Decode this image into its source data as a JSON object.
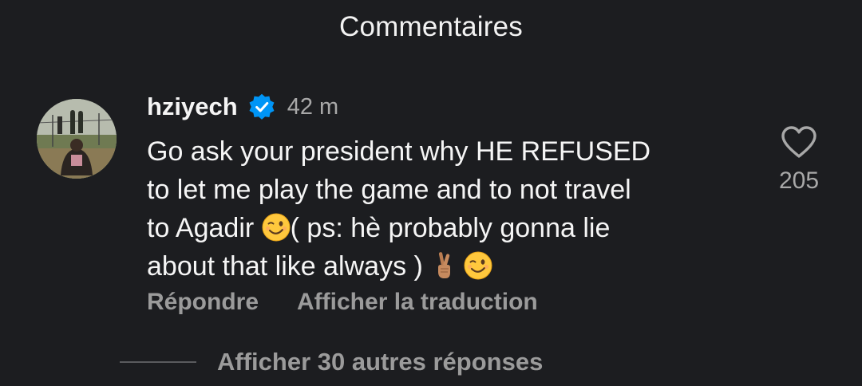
{
  "header": {
    "title": "Commentaires"
  },
  "comment": {
    "username": "hziyech",
    "verified": true,
    "time": "42 m",
    "text_part1": "Go ask your president why HE REFUSED\nto let me play the game and to not travel\nto Agadir ",
    "text_part2": "( ps: hè probably gonna lie\nabout that like always ) ",
    "emojis": [
      "winking-face-emoji",
      "crossed-fingers-emoji",
      "winking-face-emoji"
    ],
    "likes": "205",
    "actions": {
      "reply": "Répondre",
      "translate": "Afficher la traduction"
    }
  },
  "replies": {
    "more_label": "Afficher 30 autres réponses"
  },
  "colors": {
    "background": "#1c1d20",
    "text_primary": "#f5f5f5",
    "text_secondary": "#a8a8a8",
    "verified_blue": "#0095f6"
  }
}
